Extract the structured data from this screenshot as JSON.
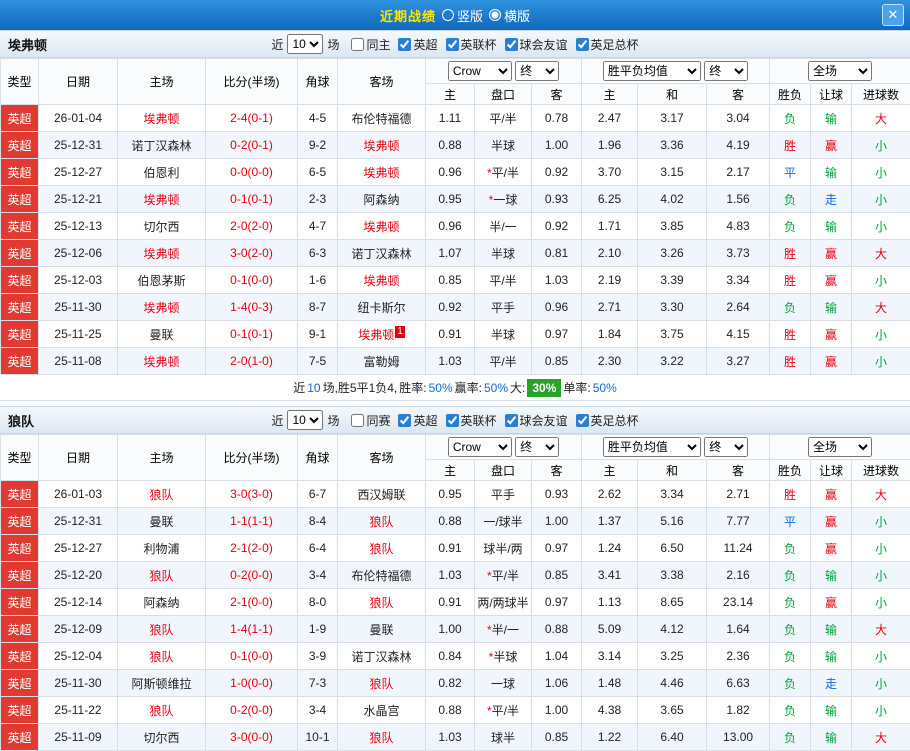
{
  "colors": {
    "red": "#e60012",
    "green": "#00a23f",
    "blue": "#0b6cd4",
    "league": "#e13b31",
    "badge": "#27a427"
  },
  "titlebar": {
    "title": "近期战绩",
    "radio_vertical": "竖版",
    "radio_horizontal": "横版",
    "close_icon": "✕"
  },
  "columns": {
    "type": "类型",
    "date": "日期",
    "home": "主场",
    "score": "比分(半场)",
    "corner": "角球",
    "away": "客场",
    "bookmaker": "Crow",
    "final": "终",
    "euro_avg": "胜平负均值",
    "full_match": "全场",
    "asian_home": "主",
    "handicap": "盘口",
    "asian_away": "客",
    "euro_home": "主",
    "euro_draw": "和",
    "euro_away": "客",
    "result": "胜负",
    "handicap_result": "让球",
    "goals": "进球数"
  },
  "sections": [
    {
      "team": "埃弗顿",
      "filter": {
        "recent": "近",
        "count": "10",
        "unit": "场",
        "checkboxes": [
          {
            "label": "同主",
            "checked": false
          },
          {
            "label": "英超",
            "checked": true
          },
          {
            "label": "英联杯",
            "checked": true
          },
          {
            "label": "球会友谊",
            "checked": true
          },
          {
            "label": "英足总杯",
            "checked": true
          }
        ]
      },
      "rows": [
        {
          "league": "英超",
          "date": "26-01-04",
          "home": "埃弗顿",
          "score": "2-4(0-1)",
          "corner": "4-5",
          "away": "布伦特福德",
          "asian": [
            "1.11",
            "平/半",
            "0.78"
          ],
          "euro": [
            "2.47",
            "3.17",
            "3.04"
          ],
          "result": "负",
          "handicap_result": "输",
          "goals": "大"
        },
        {
          "league": "英超",
          "date": "25-12-31",
          "home": "诺丁汉森林",
          "score": "0-2(0-1)",
          "corner": "9-2",
          "away": "埃弗顿",
          "asian": [
            "0.88",
            "半球",
            "1.00"
          ],
          "euro": [
            "1.96",
            "3.36",
            "4.19"
          ],
          "result": "胜",
          "handicap_result": "赢",
          "goals": "小"
        },
        {
          "league": "英超",
          "date": "25-12-27",
          "home": "伯恩利",
          "score": "0-0(0-0)",
          "corner": "6-5",
          "away": "埃弗顿",
          "asian": [
            "0.96",
            "*平/半",
            "0.92"
          ],
          "euro": [
            "3.70",
            "3.15",
            "2.17"
          ],
          "result": "平",
          "handicap_result": "输",
          "goals": "小"
        },
        {
          "league": "英超",
          "date": "25-12-21",
          "home": "埃弗顿",
          "score": "0-1(0-1)",
          "corner": "2-3",
          "away": "阿森纳",
          "asian": [
            "0.95",
            "*一球",
            "0.93"
          ],
          "euro": [
            "6.25",
            "4.02",
            "1.56"
          ],
          "result": "负",
          "handicap_result": "走",
          "goals": "小"
        },
        {
          "league": "英超",
          "date": "25-12-13",
          "home": "切尔西",
          "score": "2-0(2-0)",
          "corner": "4-7",
          "away": "埃弗顿",
          "asian": [
            "0.96",
            "半/一",
            "0.92"
          ],
          "euro": [
            "1.71",
            "3.85",
            "4.83"
          ],
          "result": "负",
          "handicap_result": "输",
          "goals": "小"
        },
        {
          "league": "英超",
          "date": "25-12-06",
          "home": "埃弗顿",
          "score": "3-0(2-0)",
          "corner": "6-3",
          "away": "诺丁汉森林",
          "asian": [
            "1.07",
            "半球",
            "0.81"
          ],
          "euro": [
            "2.10",
            "3.26",
            "3.73"
          ],
          "result": "胜",
          "handicap_result": "赢",
          "goals": "大"
        },
        {
          "league": "英超",
          "date": "25-12-03",
          "home": "伯恩茅斯",
          "score": "0-1(0-0)",
          "corner": "1-6",
          "away": "埃弗顿",
          "asian": [
            "0.85",
            "平/半",
            "1.03"
          ],
          "euro": [
            "2.19",
            "3.39",
            "3.34"
          ],
          "result": "胜",
          "handicap_result": "赢",
          "goals": "小"
        },
        {
          "league": "英超",
          "date": "25-11-30",
          "home": "埃弗顿",
          "score": "1-4(0-3)",
          "corner": "8-7",
          "away": "纽卡斯尔",
          "asian": [
            "0.92",
            "平手",
            "0.96"
          ],
          "euro": [
            "2.71",
            "3.30",
            "2.64"
          ],
          "result": "负",
          "handicap_result": "输",
          "goals": "大"
        },
        {
          "league": "英超",
          "date": "25-11-25",
          "home": "曼联",
          "score": "0-1(0-1)",
          "corner": "9-1",
          "away": "埃弗顿",
          "away_badge": "1",
          "asian": [
            "0.91",
            "半球",
            "0.97"
          ],
          "euro": [
            "1.84",
            "3.75",
            "4.15"
          ],
          "result": "胜",
          "handicap_result": "赢",
          "goals": "小"
        },
        {
          "league": "英超",
          "date": "25-11-08",
          "home": "埃弗顿",
          "score": "2-0(1-0)",
          "corner": "7-5",
          "away": "富勒姆",
          "asian": [
            "1.03",
            "平/半",
            "0.85"
          ],
          "euro": [
            "2.30",
            "3.22",
            "3.27"
          ],
          "result": "胜",
          "handicap_result": "赢",
          "goals": "小"
        }
      ],
      "summary": [
        {
          "t": "近"
        },
        {
          "t": "10",
          "c": "blue"
        },
        {
          "t": "场,胜5平1负4,"
        },
        {
          "t": "胜率:"
        },
        {
          "t": "50%",
          "c": "blue"
        },
        {
          "t": " 赢率:"
        },
        {
          "t": "50%",
          "c": "blue"
        },
        {
          "t": " 大:"
        },
        {
          "t": "30%",
          "c": "badge"
        },
        {
          "t": " 单率:"
        },
        {
          "t": "50%",
          "c": "blue"
        }
      ]
    },
    {
      "team": "狼队",
      "filter": {
        "recent": "近",
        "count": "10",
        "unit": "场",
        "checkboxes": [
          {
            "label": "同赛",
            "checked": false
          },
          {
            "label": "英超",
            "checked": true
          },
          {
            "label": "英联杯",
            "checked": true
          },
          {
            "label": "球会友谊",
            "checked": true
          },
          {
            "label": "英足总杯",
            "checked": true
          }
        ]
      },
      "rows": [
        {
          "league": "英超",
          "date": "26-01-03",
          "home": "狼队",
          "score": "3-0(3-0)",
          "corner": "6-7",
          "away": "西汉姆联",
          "asian": [
            "0.95",
            "平手",
            "0.93"
          ],
          "euro": [
            "2.62",
            "3.34",
            "2.71"
          ],
          "result": "胜",
          "handicap_result": "赢",
          "goals": "大"
        },
        {
          "league": "英超",
          "date": "25-12-31",
          "home": "曼联",
          "score": "1-1(1-1)",
          "corner": "8-4",
          "away": "狼队",
          "asian": [
            "0.88",
            "一/球半",
            "1.00"
          ],
          "euro": [
            "1.37",
            "5.16",
            "7.77"
          ],
          "result": "平",
          "handicap_result": "赢",
          "goals": "小"
        },
        {
          "league": "英超",
          "date": "25-12-27",
          "home": "利物浦",
          "score": "2-1(2-0)",
          "corner": "6-4",
          "away": "狼队",
          "asian": [
            "0.91",
            "球半/两",
            "0.97"
          ],
          "euro": [
            "1.24",
            "6.50",
            "11.24"
          ],
          "result": "负",
          "handicap_result": "赢",
          "goals": "小"
        },
        {
          "league": "英超",
          "date": "25-12-20",
          "home": "狼队",
          "score": "0-2(0-0)",
          "corner": "3-4",
          "away": "布伦特福德",
          "asian": [
            "1.03",
            "*平/半",
            "0.85"
          ],
          "euro": [
            "3.41",
            "3.38",
            "2.16"
          ],
          "result": "负",
          "handicap_result": "输",
          "goals": "小"
        },
        {
          "league": "英超",
          "date": "25-12-14",
          "home": "阿森纳",
          "score": "2-1(0-0)",
          "corner": "8-0",
          "away": "狼队",
          "asian": [
            "0.91",
            "两/两球半",
            "0.97"
          ],
          "euro": [
            "1.13",
            "8.65",
            "23.14"
          ],
          "result": "负",
          "handicap_result": "赢",
          "goals": "小"
        },
        {
          "league": "英超",
          "date": "25-12-09",
          "home": "狼队",
          "score": "1-4(1-1)",
          "corner": "1-9",
          "away": "曼联",
          "asian": [
            "1.00",
            "*半/一",
            "0.88"
          ],
          "euro": [
            "5.09",
            "4.12",
            "1.64"
          ],
          "result": "负",
          "handicap_result": "输",
          "goals": "大"
        },
        {
          "league": "英超",
          "date": "25-12-04",
          "home": "狼队",
          "score": "0-1(0-0)",
          "corner": "3-9",
          "away": "诺丁汉森林",
          "asian": [
            "0.84",
            "*半球",
            "1.04"
          ],
          "euro": [
            "3.14",
            "3.25",
            "2.36"
          ],
          "result": "负",
          "handicap_result": "输",
          "goals": "小"
        },
        {
          "league": "英超",
          "date": "25-11-30",
          "home": "阿斯顿维拉",
          "score": "1-0(0-0)",
          "corner": "7-3",
          "away": "狼队",
          "asian": [
            "0.82",
            "一球",
            "1.06"
          ],
          "euro": [
            "1.48",
            "4.46",
            "6.63"
          ],
          "result": "负",
          "handicap_result": "走",
          "goals": "小"
        },
        {
          "league": "英超",
          "date": "25-11-22",
          "home": "狼队",
          "score": "0-2(0-0)",
          "corner": "3-4",
          "away": "水晶宫",
          "asian": [
            "0.88",
            "*平/半",
            "1.00"
          ],
          "euro": [
            "4.38",
            "3.65",
            "1.82"
          ],
          "result": "负",
          "handicap_result": "输",
          "goals": "小"
        },
        {
          "league": "英超",
          "date": "25-11-09",
          "home": "切尔西",
          "score": "3-0(0-0)",
          "corner": "10-1",
          "away": "狼队",
          "asian": [
            "1.03",
            "球半",
            "0.85"
          ],
          "euro": [
            "1.22",
            "6.40",
            "13.00"
          ],
          "result": "负",
          "handicap_result": "输",
          "goals": "大"
        }
      ],
      "summary": []
    }
  ]
}
